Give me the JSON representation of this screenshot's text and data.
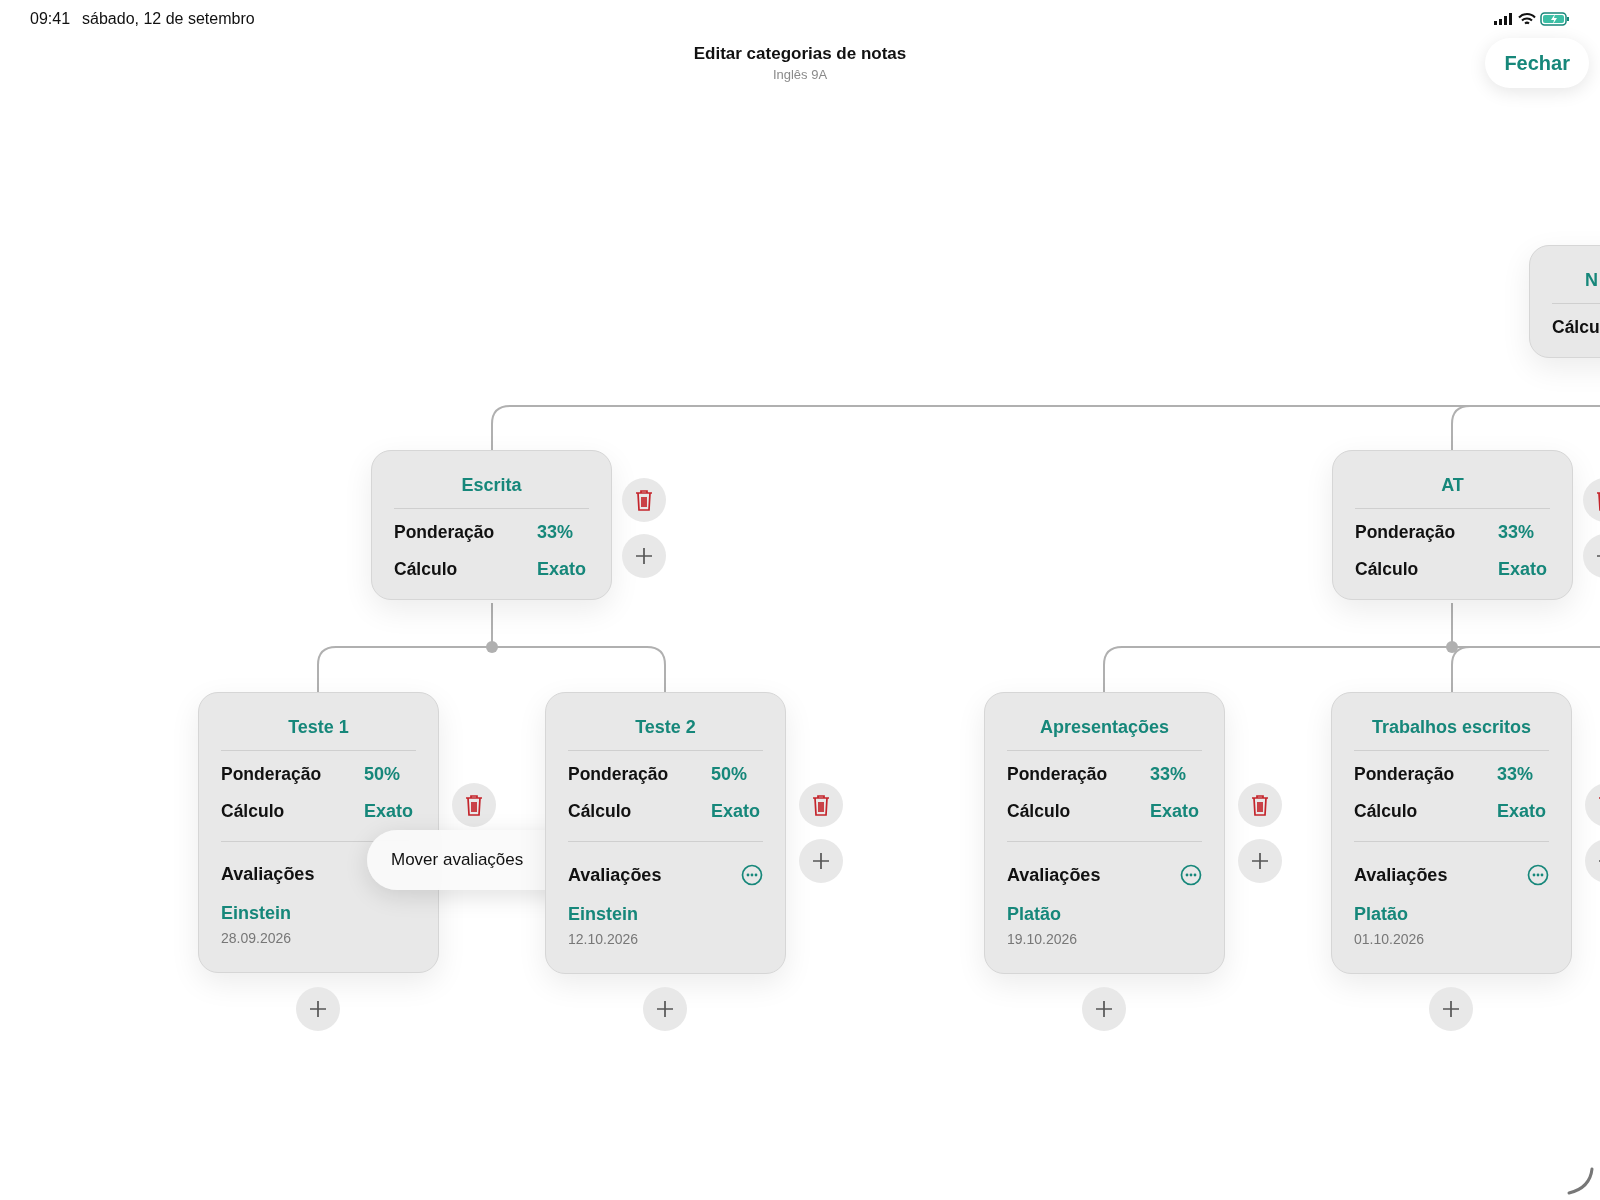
{
  "status_bar": {
    "time": "09:41",
    "date": "sábado, 12 de setembro"
  },
  "header": {
    "title": "Editar categorias de notas",
    "subtitle": "Inglês 9A"
  },
  "close_button": {
    "label": "Fechar"
  },
  "nodes": [
    {
      "kind": "root",
      "title": "N",
      "rows": [
        {
          "label": "Cálcu"
        }
      ]
    },
    {
      "kind": "category",
      "title": "Escrita",
      "rows": [
        {
          "label": "Ponderação",
          "value": "33%"
        },
        {
          "label": "Cálculo",
          "value": "Exato"
        }
      ]
    },
    {
      "kind": "category",
      "title": "AT",
      "rows": [
        {
          "label": "Ponderação",
          "value": "33%"
        },
        {
          "label": "Cálculo",
          "value": "Exato"
        }
      ]
    },
    {
      "kind": "leaf",
      "title": "Teste 1",
      "rows": [
        {
          "label": "Ponderação",
          "value": "50%"
        },
        {
          "label": "Cálculo",
          "value": "Exato"
        }
      ],
      "assessments_label": "Avaliações",
      "assessments": [
        {
          "name": "Einstein",
          "date": "28.09.2026"
        }
      ],
      "context_menu": {
        "items": [
          "Mover avaliações"
        ]
      }
    },
    {
      "kind": "leaf",
      "title": "Teste 2",
      "rows": [
        {
          "label": "Ponderação",
          "value": "50%"
        },
        {
          "label": "Cálculo",
          "value": "Exato"
        }
      ],
      "assessments_label": "Avaliações",
      "assessments": [
        {
          "name": "Einstein",
          "date": "12.10.2026"
        }
      ]
    },
    {
      "kind": "leaf",
      "title": "Apresentações",
      "rows": [
        {
          "label": "Ponderação",
          "value": "33%"
        },
        {
          "label": "Cálculo",
          "value": "Exato"
        }
      ],
      "assessments_label": "Avaliações",
      "assessments": [
        {
          "name": "Platão",
          "date": "19.10.2026"
        }
      ]
    },
    {
      "kind": "leaf",
      "title": "Trabalhos escritos",
      "rows": [
        {
          "label": "Ponderação",
          "value": "33%"
        },
        {
          "label": "Cálculo",
          "value": "Exato"
        }
      ],
      "assessments_label": "Avaliações",
      "assessments": [
        {
          "name": "Platão",
          "date": "01.10.2026"
        }
      ]
    }
  ]
}
